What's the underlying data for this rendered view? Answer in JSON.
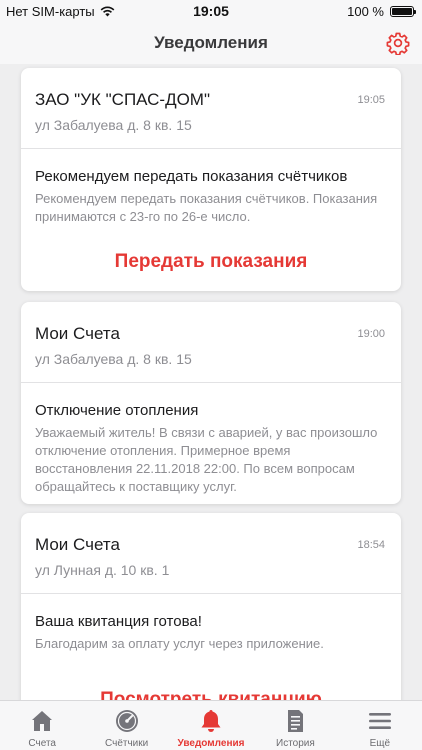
{
  "status_bar": {
    "carrier": "Нет SIM-карты",
    "time": "19:05",
    "battery": "100 %"
  },
  "nav": {
    "title": "Уведомления",
    "settings_icon": "gear-icon"
  },
  "notifications": [
    {
      "org": "ЗАО \"УК \"СПАС-ДОМ\"",
      "time": "19:05",
      "address": "ул Забалуева д. 8 кв. 15",
      "subject": "Рекомендуем передать показания счётчиков",
      "message": "Рекомендуем передать показания счётчиков. Показания принимаются с 23-го по 26-е число.",
      "action": "Передать показания"
    },
    {
      "org": "Мои Счета",
      "time": "19:00",
      "address": "ул Забалуева д. 8 кв. 15",
      "subject": "Отключение отопления",
      "message": "Уважаемый житель! В связи с аварией, у вас произошло отключение отопления. Примерное время восстановления 22.11.2018 22:00. По всем вопросам обращайтесь к поставщику услуг."
    },
    {
      "org": "Мои Счета",
      "time": "18:54",
      "address": "ул Лунная д. 10 кв. 1",
      "subject": "Ваша квитанция готова!",
      "message": "Благодарим за оплату услуг через приложение.",
      "action": "Посмотреть квитанцию"
    }
  ],
  "tabs": [
    {
      "label": "Счета",
      "icon": "home-icon"
    },
    {
      "label": "Счётчики",
      "icon": "gauge-icon"
    },
    {
      "label": "Уведомления",
      "icon": "bell-icon",
      "active": true
    },
    {
      "label": "История",
      "icon": "document-icon"
    },
    {
      "label": "Ещё",
      "icon": "menu-icon"
    }
  ],
  "colors": {
    "accent": "#e53935",
    "secondary_text": "#8e8e93",
    "icon_gray": "#74747a"
  }
}
